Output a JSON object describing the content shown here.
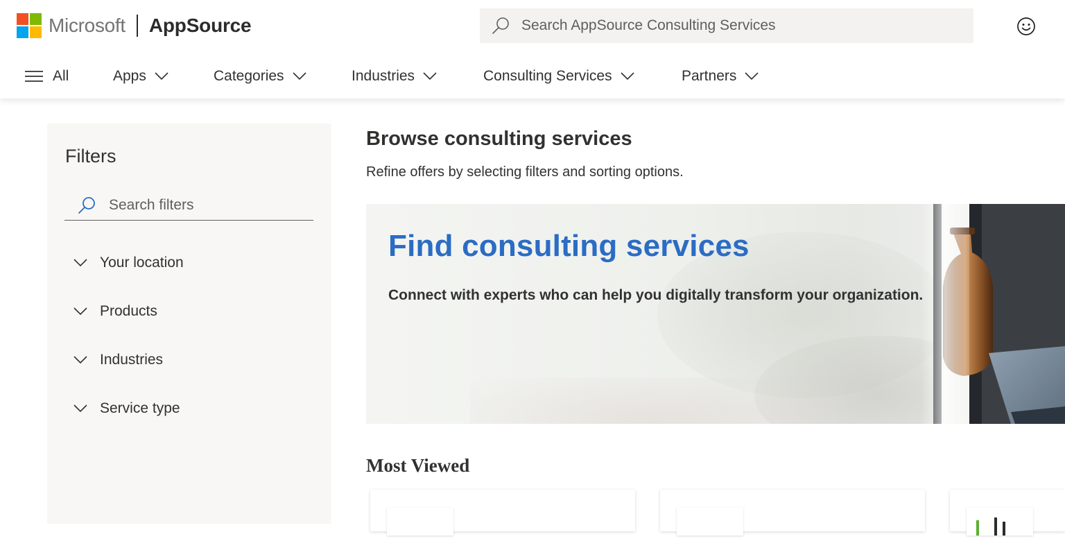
{
  "brand": {
    "company": "Microsoft",
    "product": "AppSource",
    "logo_colors": [
      "#f25022",
      "#7fba00",
      "#00a4ef",
      "#ffb900"
    ]
  },
  "search": {
    "placeholder": "Search AppSource Consulting Services",
    "value": ""
  },
  "feedback": {
    "icon": "smiley-icon"
  },
  "nav": {
    "all_label": "All",
    "items": [
      {
        "label": "Apps"
      },
      {
        "label": "Categories"
      },
      {
        "label": "Industries"
      },
      {
        "label": "Consulting Services"
      },
      {
        "label": "Partners"
      }
    ]
  },
  "filters": {
    "title": "Filters",
    "search_placeholder": "Search filters",
    "groups": [
      {
        "label": "Your location"
      },
      {
        "label": "Products"
      },
      {
        "label": "Industries"
      },
      {
        "label": "Service type"
      }
    ]
  },
  "main": {
    "title": "Browse consulting services",
    "subtitle": "Refine offers by selecting filters and sorting options.",
    "hero": {
      "title": "Find consulting services",
      "description": "Connect with experts who can help you digitally transform your organization."
    },
    "section_title": "Most Viewed"
  },
  "colors": {
    "accent_blue": "#2b6cc4",
    "text": "#323130",
    "panel_bg": "#f8f7f5"
  }
}
